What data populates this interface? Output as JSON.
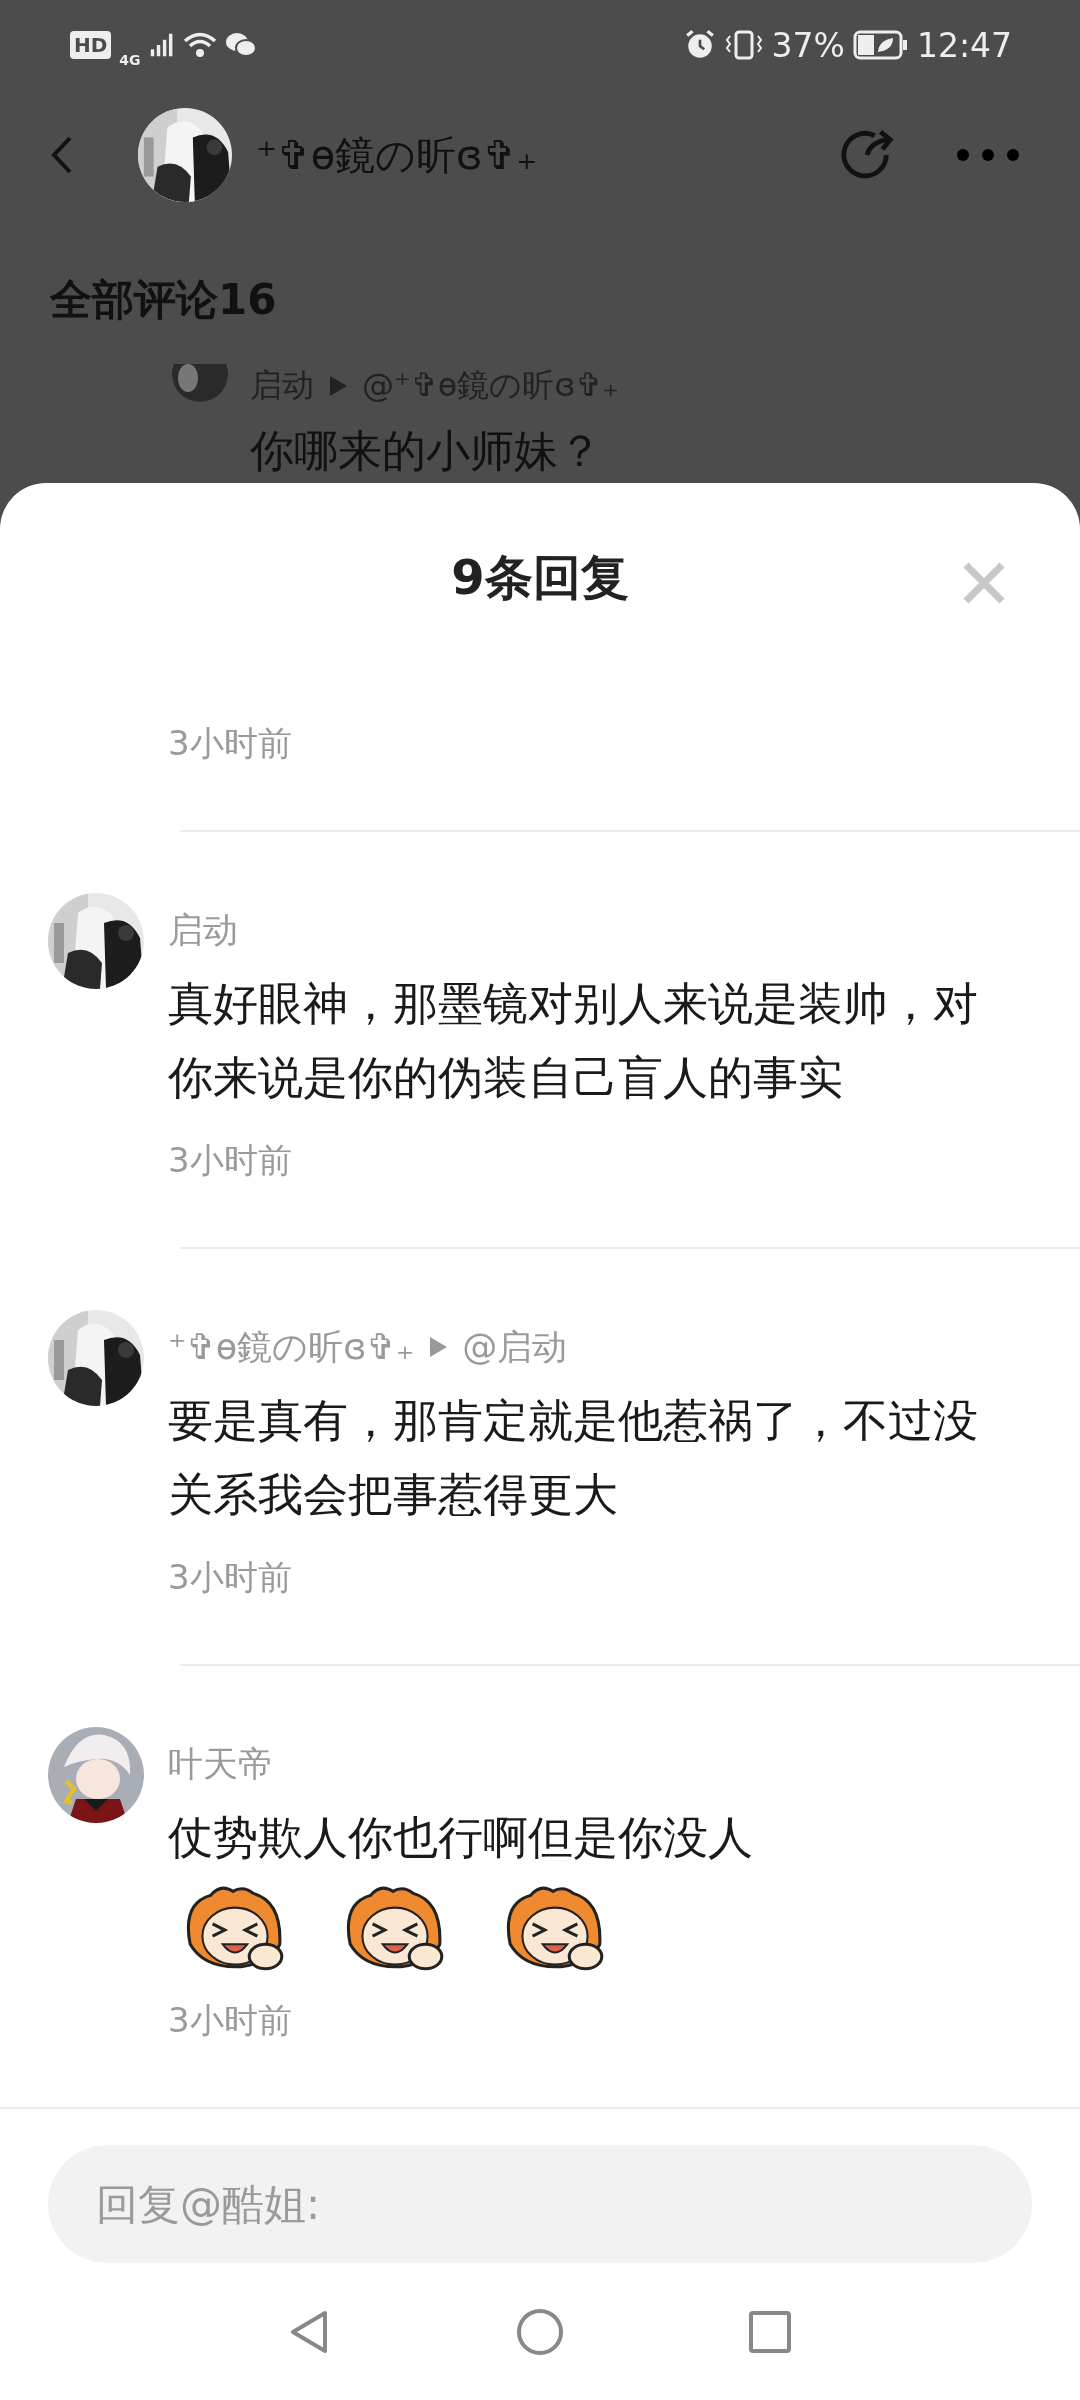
{
  "status_bar": {
    "badge": "HD",
    "network": "4G",
    "battery": "37%",
    "time": "12:47"
  },
  "header": {
    "title": "⁺✞ɵ鏡の昕ɞ✞₊"
  },
  "comments_heading": "全部评论16",
  "background_reply": {
    "author": "启动",
    "reply_to": "@⁺✞ɵ鏡の昕ɞ✞₊",
    "text": "你哪来的小师妹？"
  },
  "sheet": {
    "title": "9条回复",
    "replies": [
      {
        "time": "3小时前"
      },
      {
        "author": "启动",
        "avatar": {
          "kind": "picture"
        },
        "text": "真好眼神，那墨镜对别人来说是装帅，对你来说是你的伪装自己盲人的事实",
        "time": "3小时前"
      },
      {
        "author": "⁺✞ɵ鏡の昕ɞ✞₊",
        "avatar": {
          "kind": "picture"
        },
        "reply_to": "@启动",
        "text": "要是真有，那肯定就是他惹祸了，不过没关系我会把事惹得更大",
        "time": "3小时前"
      },
      {
        "author": "叶天帝",
        "avatar": {
          "kind": "picture"
        },
        "text": "仗势欺人你也行啊但是你没人",
        "stickers": [
          {
            "kind": "laughing"
          },
          {
            "kind": "laughing"
          },
          {
            "kind": "laughing"
          }
        ],
        "time": "3小时前"
      }
    ],
    "input": {
      "placeholder": "回复@酷姐:"
    }
  }
}
